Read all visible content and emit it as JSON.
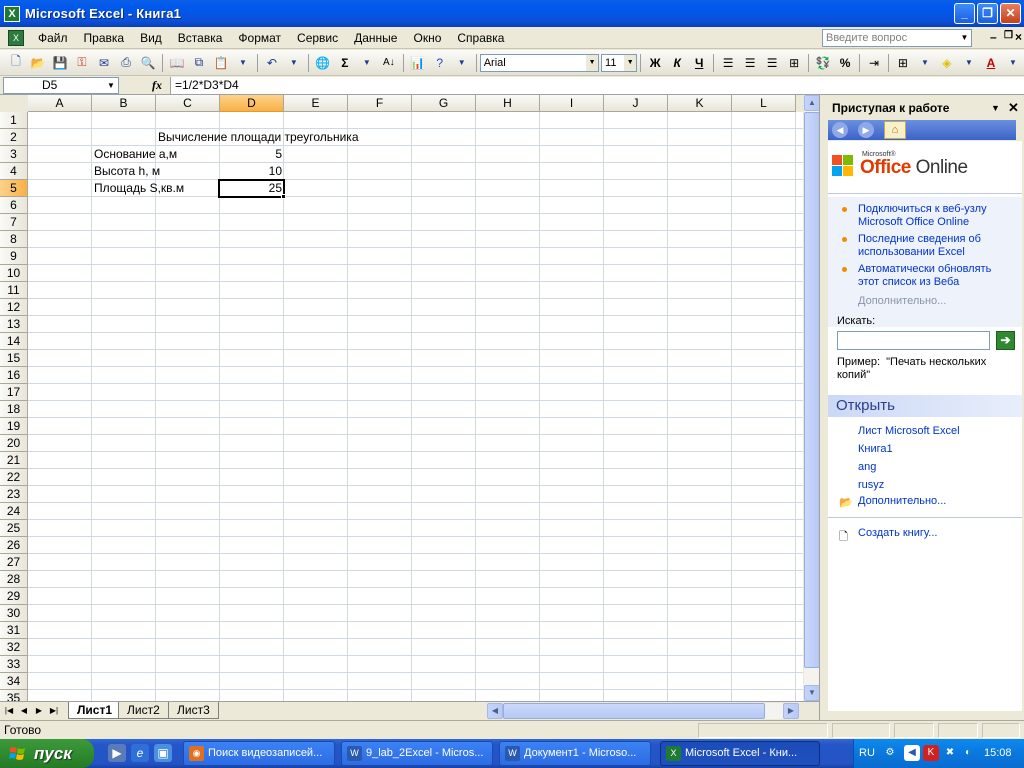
{
  "window": {
    "title": "Microsoft Excel - Книга1",
    "minimize": "_",
    "maximize": "❐",
    "close": "✕"
  },
  "menubar": {
    "items": [
      "Файл",
      "Правка",
      "Вид",
      "Вставка",
      "Формат",
      "Сервис",
      "Данные",
      "Окно",
      "Справка"
    ],
    "help_placeholder": "Введите вопрос"
  },
  "toolbar": {
    "font_name": "Arial",
    "font_size": "11",
    "sum_symbol": "Σ",
    "bold": "Ж",
    "italic": "К",
    "underline": "Ч",
    "percent": "%"
  },
  "formula_bar": {
    "name_box": "D5",
    "fx": "fx",
    "formula": "=1/2*D3*D4"
  },
  "grid": {
    "columns": [
      "A",
      "B",
      "C",
      "D",
      "E",
      "F",
      "G",
      "H",
      "I",
      "J",
      "K",
      "L"
    ],
    "rows": [
      "1",
      "2",
      "3",
      "4",
      "5",
      "6",
      "7",
      "8",
      "9",
      "10",
      "11",
      "12",
      "13",
      "14",
      "15",
      "16",
      "17",
      "18",
      "19",
      "20",
      "21",
      "22",
      "23",
      "24",
      "25",
      "26",
      "27",
      "28",
      "29",
      "30",
      "31",
      "32",
      "33",
      "34",
      "35"
    ],
    "selected_column": "D",
    "selected_row": "5",
    "cells": {
      "C2": "Вычисление площади треугольника",
      "B3": "Основание а,м",
      "D3": "5",
      "B4": "Высота h, м",
      "D4": "10",
      "B5": "Площадь S,кв.м",
      "D5": "25"
    }
  },
  "sheets": {
    "tabs": [
      "Лист1",
      "Лист2",
      "Лист3"
    ],
    "active": "Лист1"
  },
  "status": {
    "text": "Готово"
  },
  "taskpane": {
    "title": "Приступая к работе",
    "logo_small": "Microsoft®",
    "logo_text_1": "Office",
    "logo_text_2": " Online",
    "bullets": [
      "Подключиться к веб-узлу Microsoft Office Online",
      "Последние сведения об использовании Excel",
      "Автоматически обновлять этот список из Веба"
    ],
    "more": "Дополнительно...",
    "search_label": "Искать:",
    "example_label": "Пример:",
    "example_value": "\"Печать нескольких копий\"",
    "open_header": "Открыть",
    "files": [
      "Лист Microsoft Excel",
      "Книга1",
      "ang",
      "rusyz"
    ],
    "open_more": "Дополнительно...",
    "create": "Создать книгу..."
  },
  "taskbar": {
    "start": "пуск",
    "tasks": [
      "Поиск видеозаписей...",
      "9_lab_2Excel - Micros...",
      "Документ1 - Microso...",
      "Microsoft Excel - Кни..."
    ],
    "lang": "RU",
    "clock": "15:08"
  }
}
